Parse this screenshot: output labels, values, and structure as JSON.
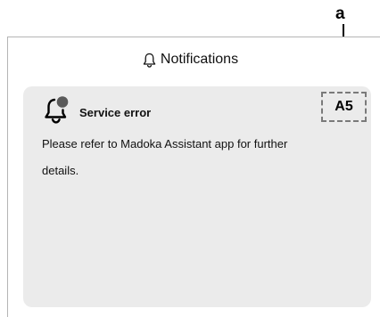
{
  "callout": {
    "label": "a"
  },
  "header": {
    "icon": "bell-outline-icon",
    "title": "Notifications"
  },
  "notification": {
    "icon": "bell-with-dot-icon",
    "title": "Service error",
    "code": "A5",
    "message": "Please refer to Madoka Assistant app for further details."
  },
  "colors": {
    "card_background": "#ebebeb",
    "frame_border": "#b5b5b5",
    "code_box_border": "#7a7a7a",
    "text": "#111111"
  }
}
